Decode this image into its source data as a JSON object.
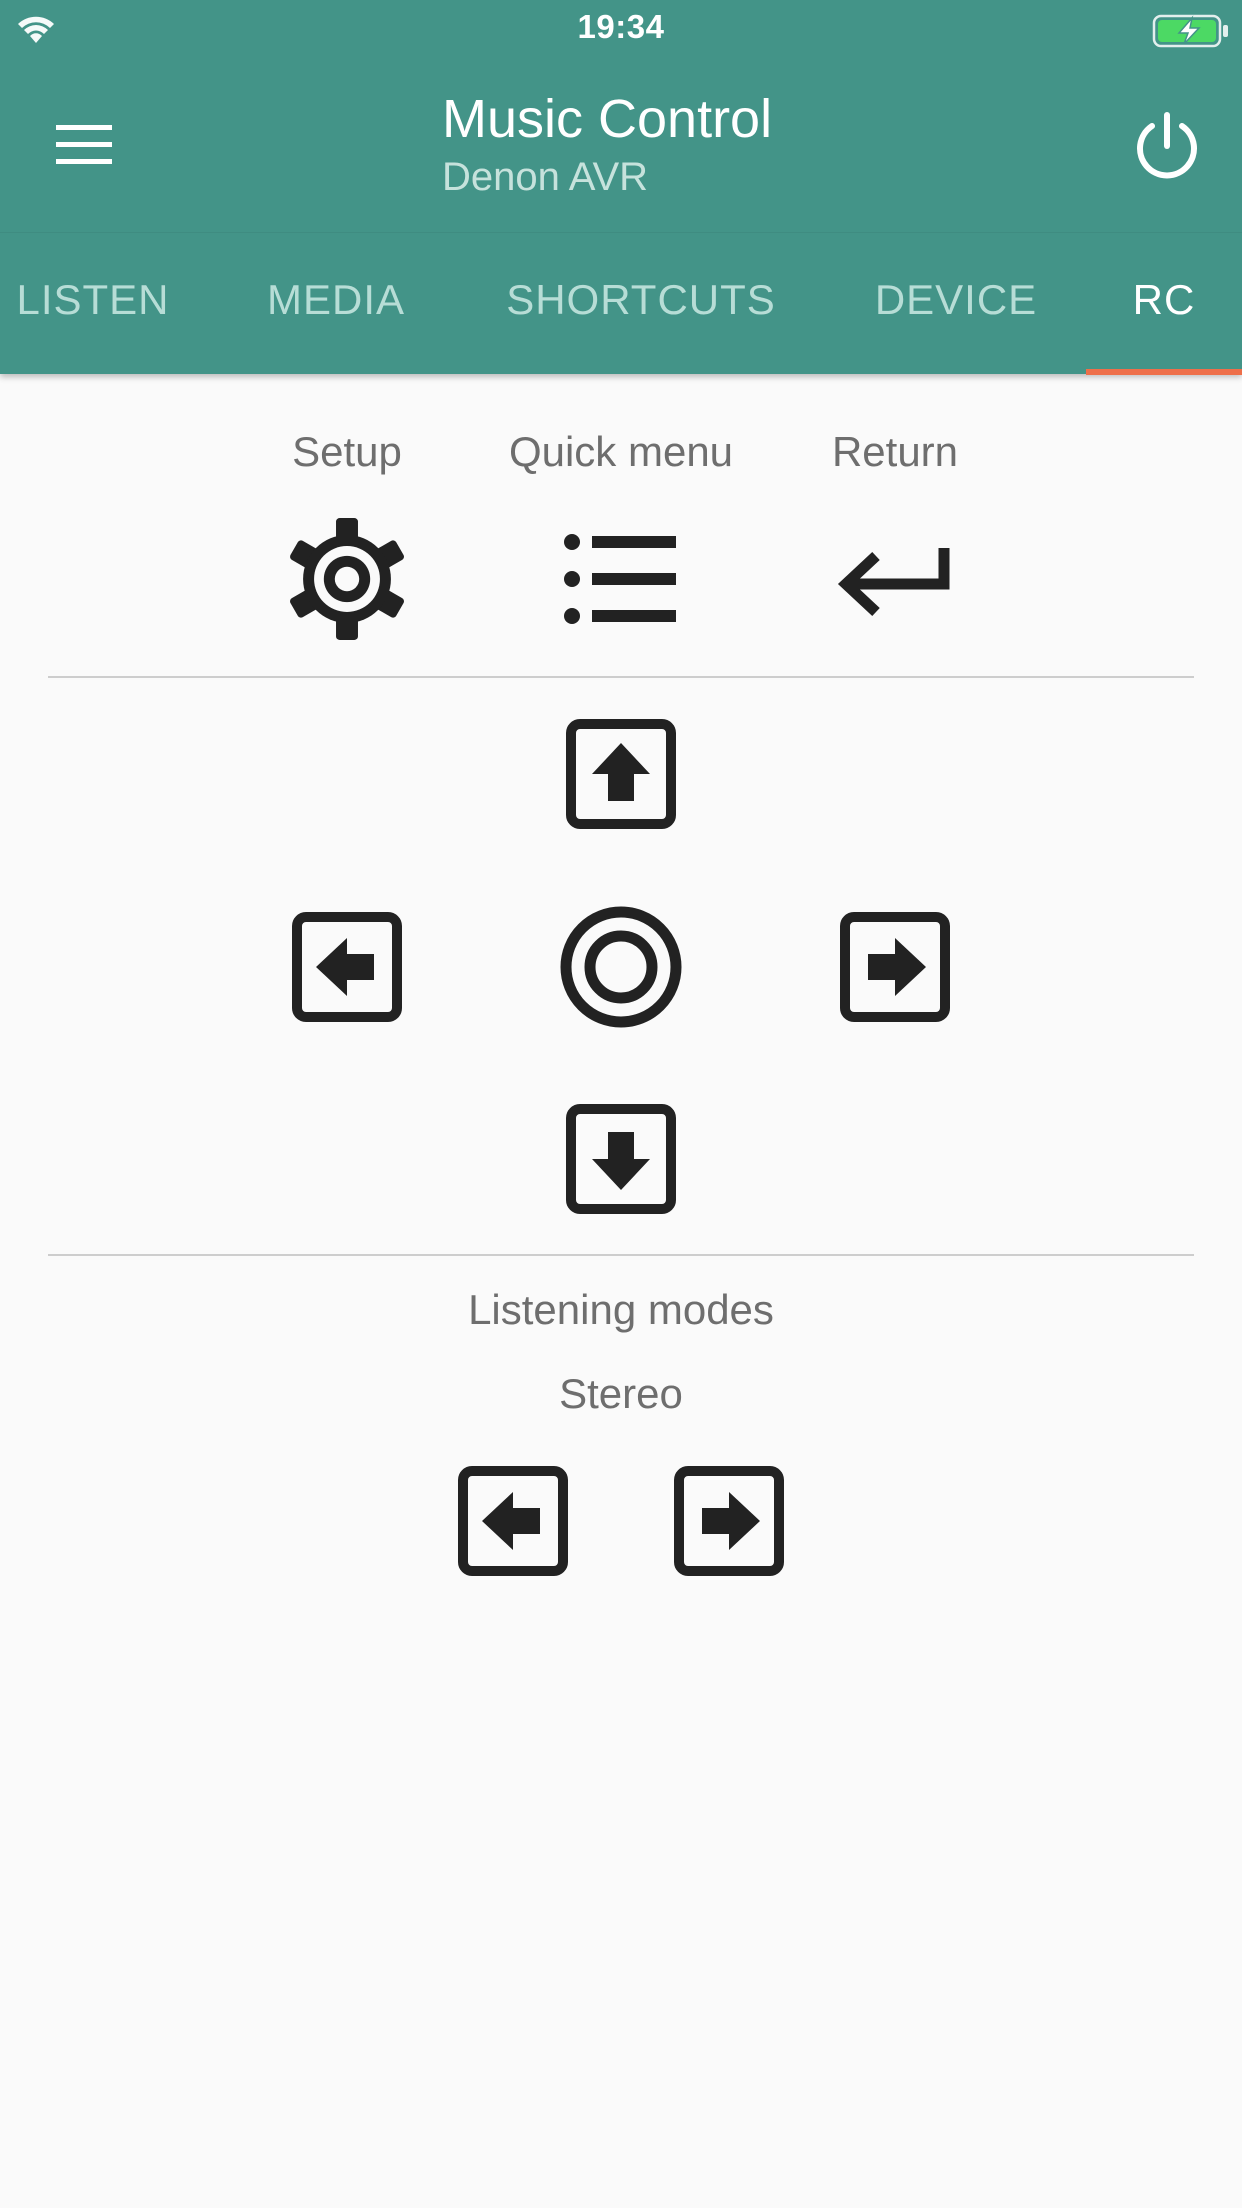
{
  "status_bar": {
    "time": "19:34"
  },
  "app_bar": {
    "title": "Music Control",
    "subtitle": "Denon AVR"
  },
  "tabs": [
    {
      "label": "LISTEN",
      "active": false
    },
    {
      "label": "MEDIA",
      "active": false
    },
    {
      "label": "SHORTCUTS",
      "active": false
    },
    {
      "label": "DEVICE",
      "active": false
    },
    {
      "label": "RC",
      "active": true
    }
  ],
  "controls": {
    "setup_label": "Setup",
    "quick_menu_label": "Quick menu",
    "return_label": "Return"
  },
  "listening_modes": {
    "title": "Listening modes",
    "current": "Stereo"
  },
  "colors": {
    "app_bar": "#439488",
    "tab_indicator": "#ee6f4a",
    "background": "#fafafa",
    "icon": "#222222",
    "battery_fill": "#4cd964"
  },
  "icons": {
    "menu": "hamburger-menu-icon",
    "power": "power-icon",
    "setup": "gear-icon",
    "quick_menu": "list-icon",
    "return": "return-arrow-icon",
    "up": "arrow-up-box-icon",
    "down": "arrow-down-box-icon",
    "left": "arrow-left-box-icon",
    "right": "arrow-right-box-icon",
    "enter": "radio-button-icon"
  }
}
